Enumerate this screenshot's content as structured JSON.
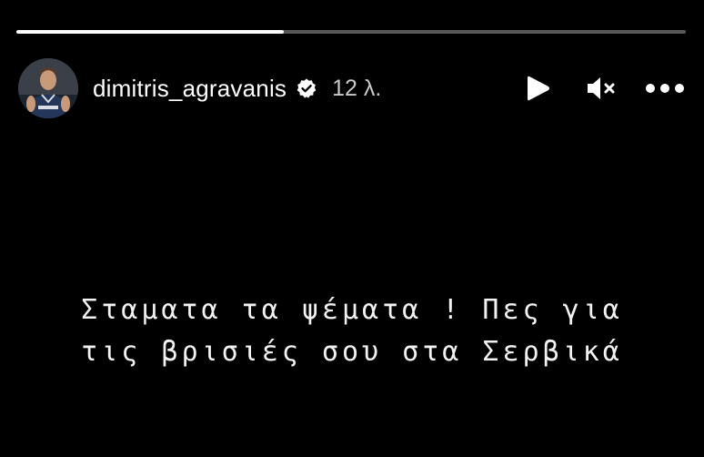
{
  "story": {
    "progress": 0.4,
    "username": "dimitris_agravanis",
    "verified": true,
    "timestamp": "12 λ.",
    "caption_lines": [
      "Σταματα τα ψέματα ! Πες για",
      "τις βρισιές σου στα Σερβικά"
    ]
  },
  "icons": {
    "verified": "verified-badge-icon",
    "play": "play-icon",
    "mute": "muted-speaker-icon",
    "more": "more-options-icon"
  },
  "colors": {
    "background": "#000000",
    "text": "#ffffff",
    "timestamp": "#c9c9c9",
    "progress_track": "rgba(255,255,255,0.35)",
    "progress_fill": "#ffffff"
  }
}
